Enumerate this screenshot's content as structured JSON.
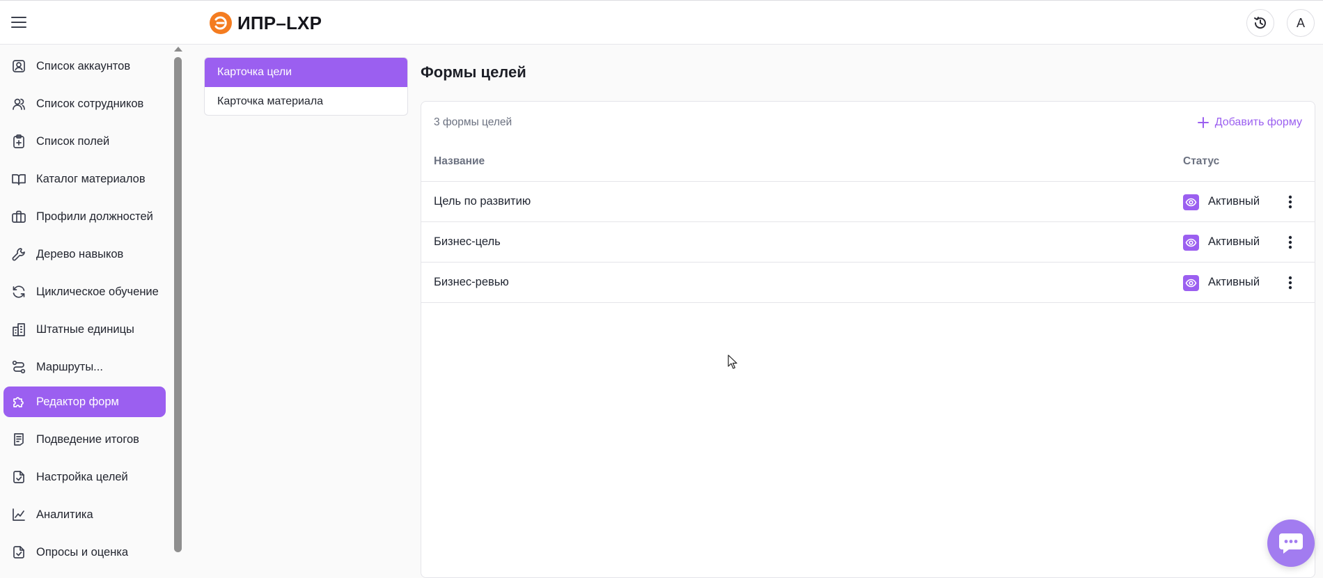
{
  "header": {
    "logo_text": "ИПР–LXP",
    "avatar_initial": "А",
    "menu_icon": "hamburger-icon",
    "history_icon": "clock-history-icon"
  },
  "sidebar": {
    "items": [
      {
        "label": "Список аккаунтов",
        "icon": "user-card-icon",
        "active": false
      },
      {
        "label": "Список сотрудников",
        "icon": "users-icon",
        "active": false
      },
      {
        "label": "Список полей",
        "icon": "clipboard-plus-icon",
        "active": false
      },
      {
        "label": "Каталог материалов",
        "icon": "book-icon",
        "active": false
      },
      {
        "label": "Профили должностей",
        "icon": "briefcase-icon",
        "active": false
      },
      {
        "label": "Дерево навыков",
        "icon": "wrench-icon",
        "active": false
      },
      {
        "label": "Циклическое обучение",
        "icon": "refresh-icon",
        "active": false
      },
      {
        "label": "Штатные единицы",
        "icon": "building-icon",
        "active": false
      },
      {
        "label": "Маршруты...",
        "icon": "route-icon",
        "active": false
      },
      {
        "label": "Редактор форм",
        "icon": "puzzle-icon",
        "active": true
      },
      {
        "label": "Подведение итогов",
        "icon": "document-list-icon",
        "active": false
      },
      {
        "label": "Настройка целей",
        "icon": "document-check-icon",
        "active": false
      },
      {
        "label": "Аналитика",
        "icon": "chart-line-icon",
        "active": false
      },
      {
        "label": "Опросы и оценка",
        "icon": "document-check-icon",
        "active": false
      }
    ]
  },
  "subnav": {
    "items": [
      {
        "label": "Карточка цели",
        "active": true
      },
      {
        "label": "Карточка материала",
        "active": false
      }
    ]
  },
  "main": {
    "title": "Формы целей",
    "count_text": "3 формы целей",
    "add_label": "Добавить форму",
    "columns": {
      "name": "Название",
      "status": "Статус"
    },
    "rows": [
      {
        "name": "Цель по развитию",
        "status": "Активный"
      },
      {
        "name": "Бизнес-цель",
        "status": "Активный"
      },
      {
        "name": "Бизнес-ревью",
        "status": "Активный"
      }
    ]
  },
  "colors": {
    "accent": "#9b5ff0",
    "logo_orange": "#f47c20",
    "chat_button": "#a27cf0"
  }
}
